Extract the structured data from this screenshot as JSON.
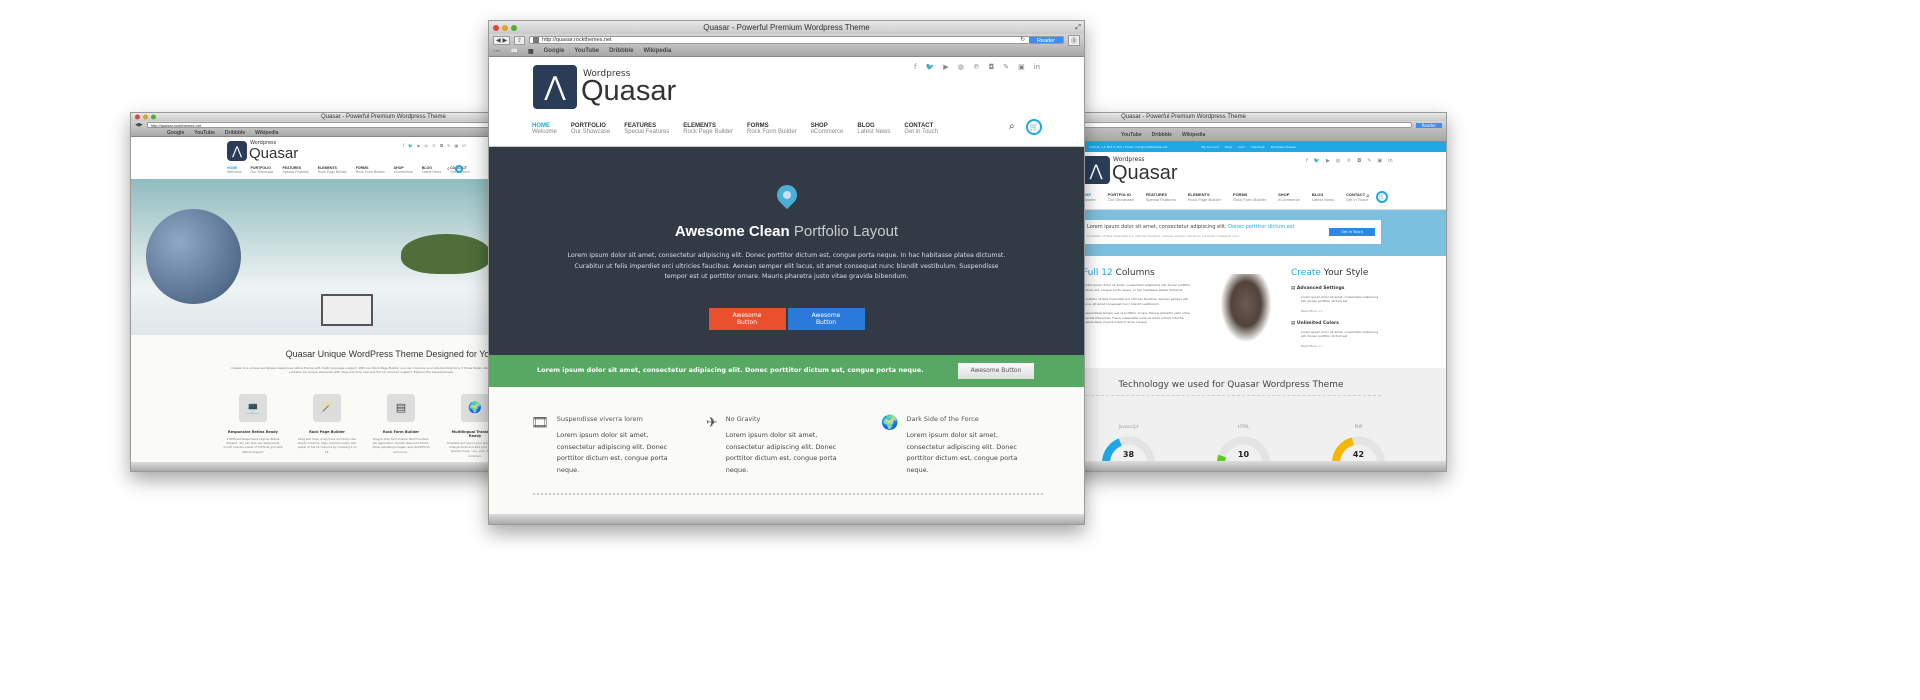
{
  "browser": {
    "title": "Quasar - Powerful Premium Wordpress Theme",
    "url": "http://quasar.rockthemes.net",
    "reader": "Reader",
    "bookmarks": [
      "Google",
      "YouTube",
      "Dribbble",
      "Wikipedia"
    ]
  },
  "logo": {
    "small": "Wordpress",
    "big": "Quasar"
  },
  "social": [
    "f",
    "t",
    "yt",
    "dr",
    "p",
    "ig",
    "fk",
    "fl",
    "in"
  ],
  "nav": [
    {
      "label": "HOME",
      "sub": "Welcome",
      "active": true,
      "dropdown": true
    },
    {
      "label": "PORTFOLIO",
      "sub": "Our Showcase"
    },
    {
      "label": "FEATURES",
      "sub": "Special Features",
      "dropdown": true
    },
    {
      "label": "ELEMENTS",
      "sub": "Rock Page Builder"
    },
    {
      "label": "FORMS",
      "sub": "Rock Form Builder"
    },
    {
      "label": "SHOP",
      "sub": "eCommerce"
    },
    {
      "label": "BLOG",
      "sub": "Latest News"
    },
    {
      "label": "CONTACT",
      "sub": "Get in Touch"
    }
  ],
  "center": {
    "hero": {
      "title_bold": "Awesome Clean",
      "title_light": "Portfolio Layout",
      "text": "Lorem ipsum dolor sit amet, consectetur adipiscing elit. Donec porttitor dictum est, congue porta neque. In hac habitasse platea dictumst. Curabitur ut felis imperdiet orci ultricies faucibus. Aenean semper elit lacus, sit amet consequat nunc blandit vestibulum. Suspendisse tempor est ut porttitor ornare. Mauris pharetra justo vitae gravida bibendum.",
      "btn1": "Awesome Button",
      "btn2": "Awesome Button"
    },
    "band": {
      "text": "Lorem ipsum dolor sit amet, consectetur adipiscing elit. Donec porttitor dictum est, congue porta neque.",
      "button": "Awesome Button"
    },
    "features": [
      {
        "icon": "film-icon",
        "title": "Suspendisse viverra lorem",
        "text": "Lorem ipsum dolor sit amet, consectetur adipiscing elit. Donec porttitor dictum est, congue porta neque."
      },
      {
        "icon": "airplane-icon",
        "title": "No Gravity",
        "text": "Lorem ipsum dolor sit amet, consectetur adipiscing elit. Donec porttitor dictum est, congue porta neque."
      },
      {
        "icon": "globe-icon",
        "title": "Dark Side of the Force",
        "text": "Lorem ipsum dolor sit amet, consectetur adipiscing elit. Donec porttitor dictum est, congue porta neque."
      }
    ]
  },
  "left": {
    "heading": "Quasar Unique WordPress Theme Designed for You",
    "desc": "Quasar is a unique wordpress responsive retina theme with multi language support. With our Rock Page Builder you can improve your site building time 3 times faster. Rock Page Builder contains 22 unique elements with drag and drop real and full 12 columns support. Explore the awesomeness",
    "features": [
      {
        "title": "Responsive Retina Ready",
        "text": "4 Different Responsive Layout, Retina Support. You can also set responsivity on/off. Use the power of full fluid grid with Retina Support"
      },
      {
        "title": "Rock Page Builder",
        "text": "Drag and drop, drag move and drop. Use empty columns, align columns easily. Use power of full 12 columns by choosing 1 to 12."
      },
      {
        "title": "Rock Form Builder",
        "text": "Drag & drop form builder. Build Contact, Job application, Human Resource Forms. Allow uploading images, add reCAPTCHA and more.."
      },
      {
        "title": "Multilingual Translation Ready",
        "text": "Translate and use in your own language. Change fonts and add your language special chars. \".po, .pot, .mo\" files included."
      }
    ]
  },
  "right": {
    "topbar_left": "Call Us: +1 555 5 555 | Email: info@rockthemes.net",
    "topbar_links": [
      "My Account",
      "Shop",
      "Cart",
      "Checkout",
      "Purchase Quasar"
    ],
    "promo": {
      "text": "Lorem ipsum dolor sit amet, consectetur adipiscing elit.",
      "highlight": "Donec porttitor dictum est",
      "sub": "Curabitur ut felis imperdiet orci ultricies faucibus. Aenean semper elit lacus, sit amet consequat nunc",
      "button": "Get in Touch"
    },
    "columns": {
      "title_hl": "Full 12",
      "title": "Columns",
      "paras": [
        "Lorem ipsum dolor sit amet, consectetur adipiscing elit. Donec porttitor dictum est, congue porta neque. In hac habitasse platea dictumst.",
        "Curabitur ut felis imperdiet orci ultricies faucibus. Aenean semper elit lacus, sit amet consequat nunc blandit vestibulum.",
        "Suspendisse tempor est ut porttitor ornare. Mauris pharetra justo vitae gravida bibendum. Fusce malesuada nulla sit amet rutrum lobortis. Suspendisse viverra lorem in enim congue"
      ]
    },
    "style": {
      "title_hl": "Create",
      "title": "Your Style",
      "items": [
        {
          "title": "Advanced Settings",
          "text": "Lorem ipsum dolor sit amet, consectetur adipiscing elit. Donec porttitor dictum est",
          "more": "Read More >>"
        },
        {
          "title": "Unlimited Colors",
          "text": "Lorem ipsum dolor sit amet, consectetur adipiscing elit. Donec porttitor dictum est",
          "more": "Read More >>"
        }
      ]
    },
    "tech": {
      "title": "Technology we used for Quasar Wordpress Theme",
      "gauges": [
        {
          "label": "Javascript",
          "value": 38,
          "color": "#1ea7e4"
        },
        {
          "label": "HTML",
          "value": 10,
          "color": "#5ccb1c"
        },
        {
          "label": "PHP",
          "value": 42,
          "color": "#f5b800"
        }
      ],
      "min": "0",
      "max": "100"
    }
  },
  "colors": {
    "accent": "#1ea7e4",
    "hero": "#323b45",
    "green": "#56a862",
    "orange": "#e8502e",
    "blue": "#2a7ad9"
  }
}
